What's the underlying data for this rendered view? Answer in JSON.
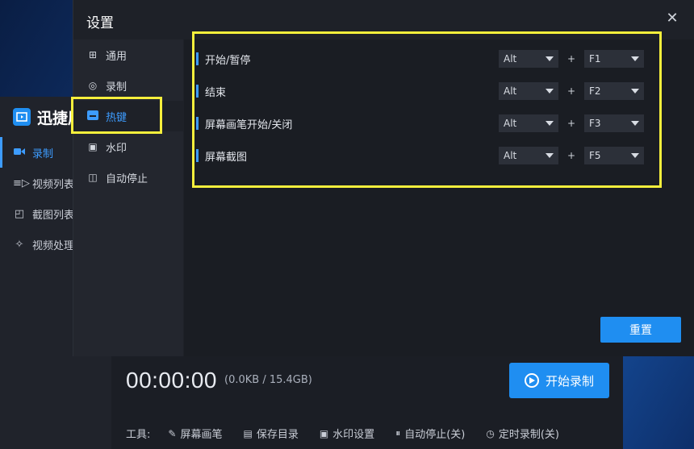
{
  "app": {
    "title": "迅捷屏",
    "nav": [
      {
        "label": "录制",
        "icon": "camera-icon"
      },
      {
        "label": "视频列表",
        "icon": "video-list-icon"
      },
      {
        "label": "截图列表",
        "icon": "screenshot-list-icon"
      },
      {
        "label": "视频处理",
        "icon": "video-tools-icon"
      }
    ]
  },
  "recorder": {
    "timer": "00:00:00",
    "size": "(0.0KB / 15.4GB)",
    "start_label": "开始录制",
    "tools_label": "工具:",
    "tools": [
      {
        "label": "屏幕画笔",
        "icon": "pen-icon"
      },
      {
        "label": "保存目录",
        "icon": "file-icon"
      },
      {
        "label": "水印设置",
        "icon": "watermark-icon"
      },
      {
        "label": "自动停止(关)",
        "icon": "pause-icon"
      },
      {
        "label": "定时录制(关)",
        "icon": "clock-icon"
      }
    ]
  },
  "dialog": {
    "title": "设置",
    "close": "✕",
    "side": [
      {
        "label": "通用",
        "icon": "grid-icon"
      },
      {
        "label": "录制",
        "icon": "record-icon"
      },
      {
        "label": "热键",
        "icon": "keyboard-icon"
      },
      {
        "label": "水印",
        "icon": "watermark-icon"
      },
      {
        "label": "自动停止",
        "icon": "pause-icon"
      }
    ],
    "hotkeys": [
      {
        "label": "开始/暂停",
        "mod": "Alt",
        "plus": "+",
        "key": "F1"
      },
      {
        "label": "结束",
        "mod": "Alt",
        "plus": "+",
        "key": "F2"
      },
      {
        "label": "屏幕画笔开始/关闭",
        "mod": "Alt",
        "plus": "+",
        "key": "F3"
      },
      {
        "label": "屏幕截图",
        "mod": "Alt",
        "plus": "+",
        "key": "F5"
      }
    ],
    "reset_label": "重置"
  },
  "colors": {
    "accent": "#1f8ef1",
    "highlight": "#f6ef3c"
  }
}
